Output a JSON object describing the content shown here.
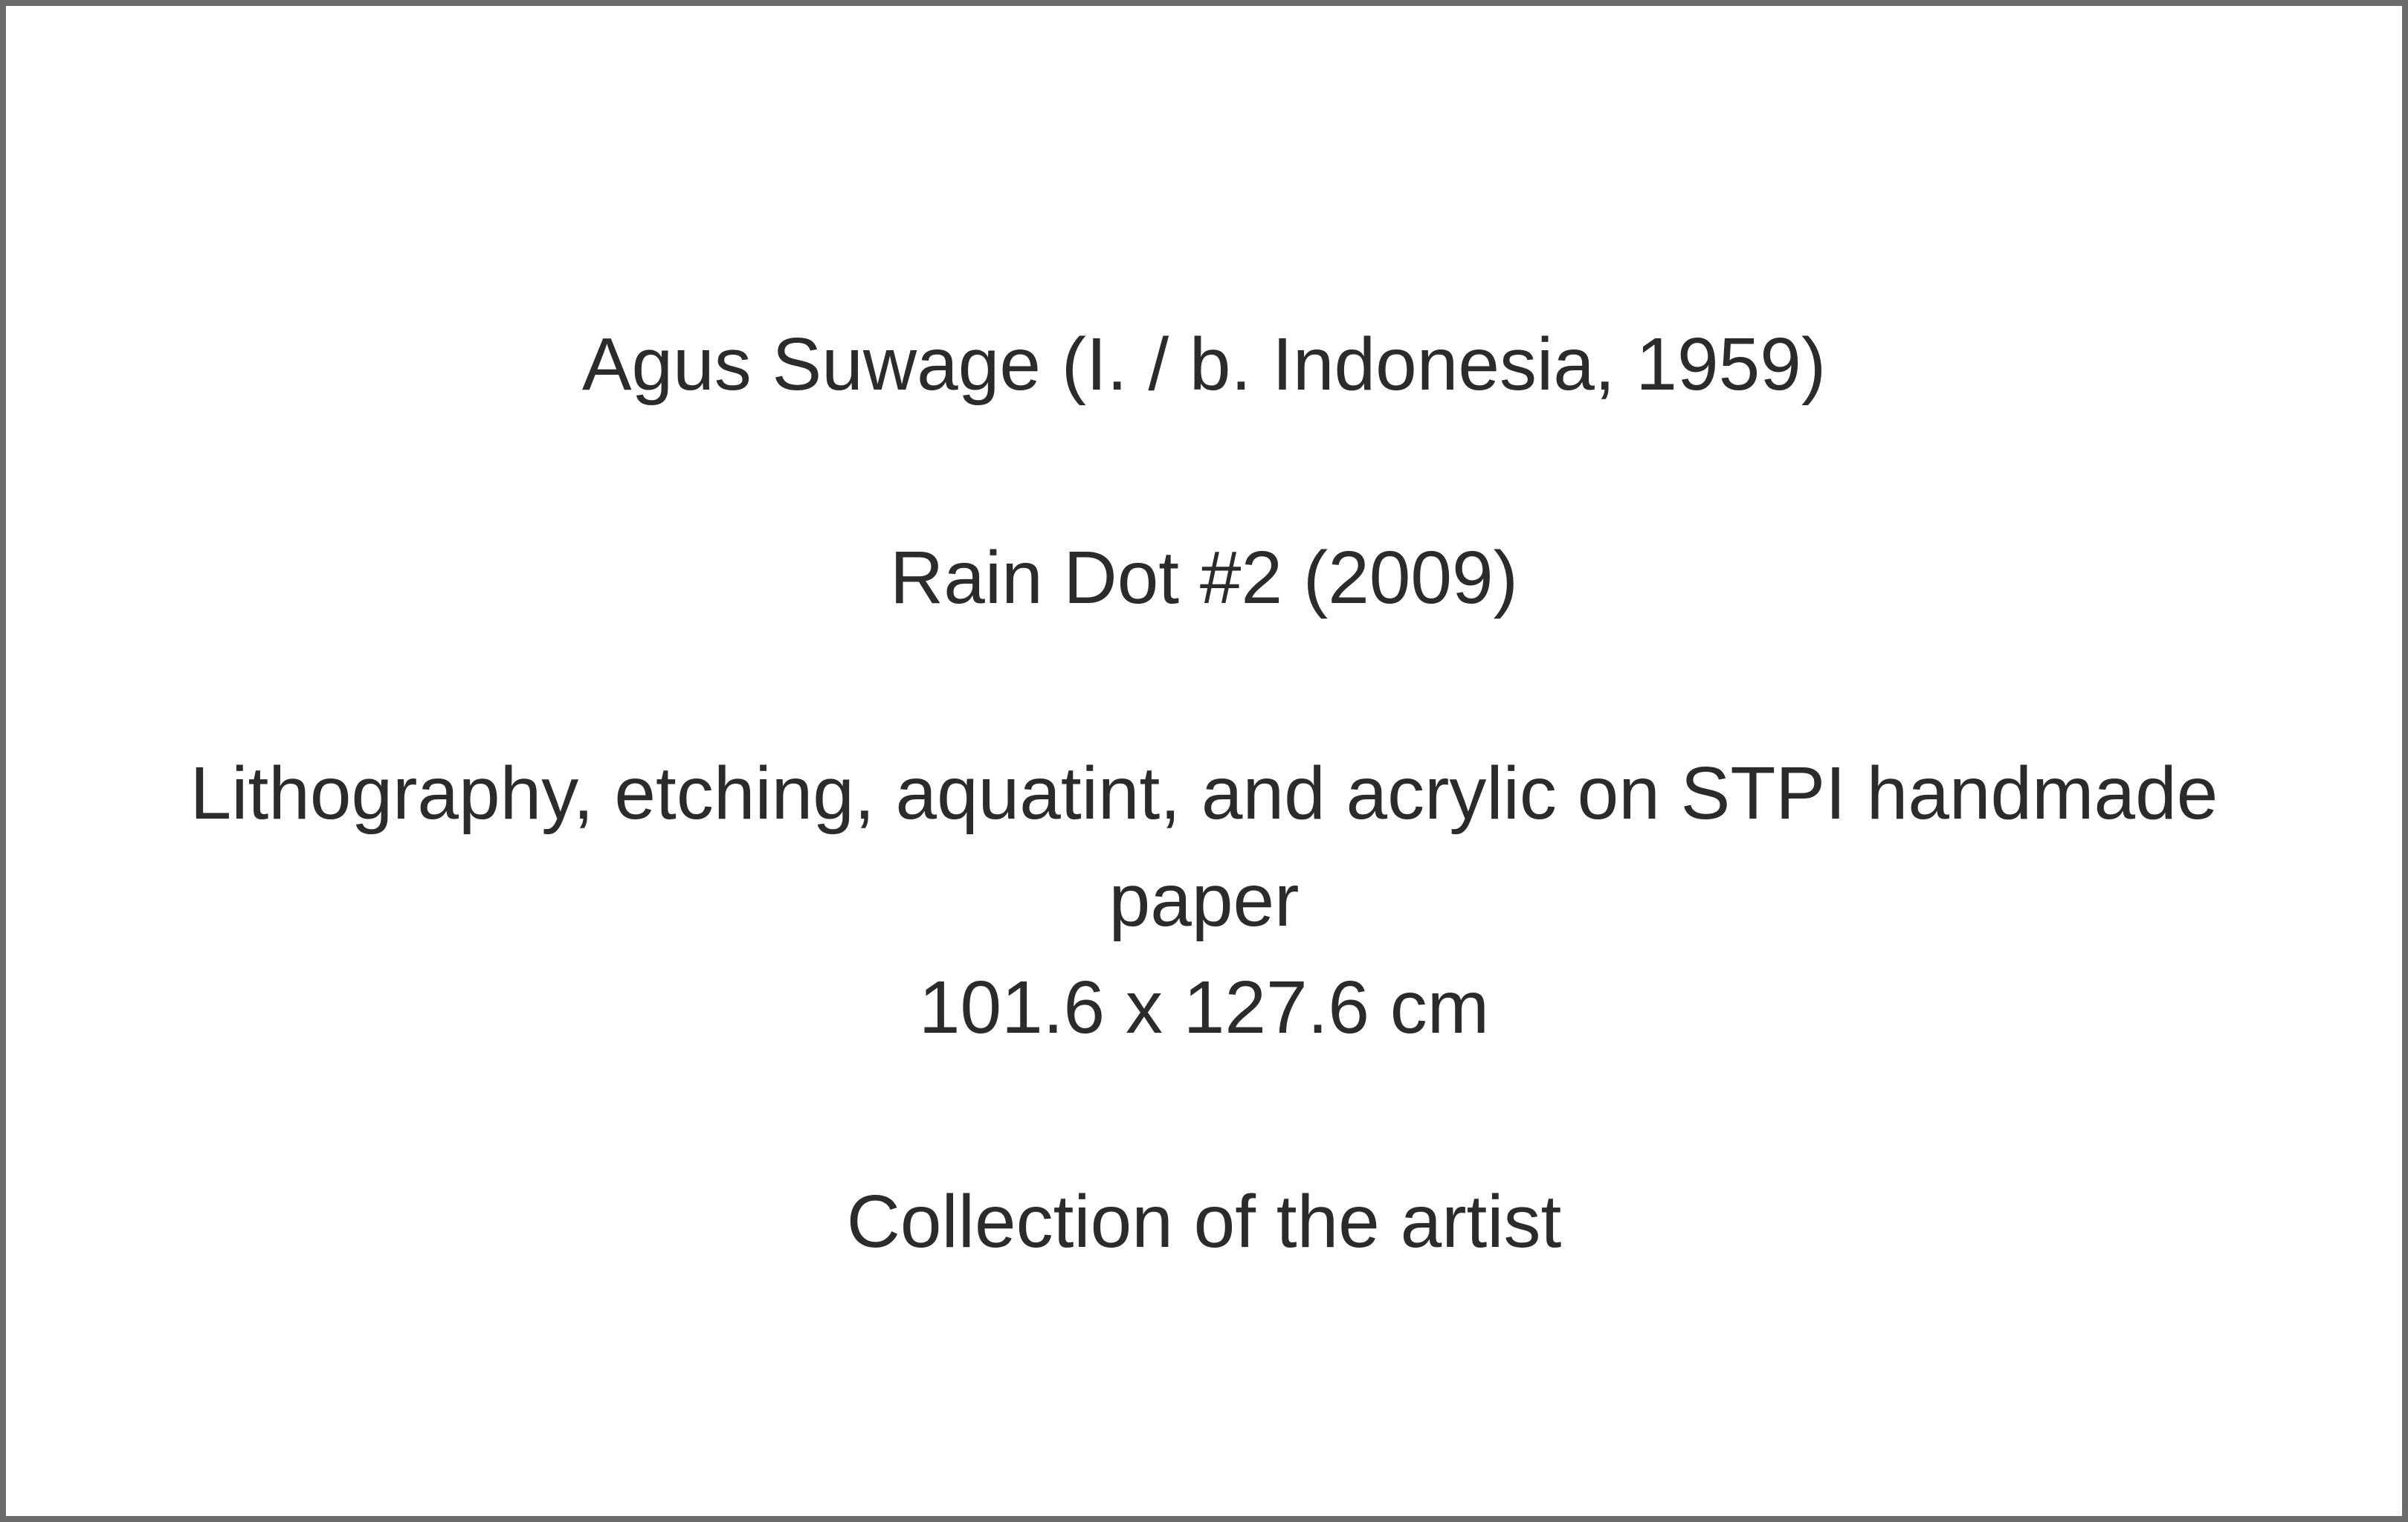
{
  "caption": {
    "artist_line": "Agus Suwage (I. / b. Indonesia, 1959)",
    "title_line": "Rain Dot #2 (2009)",
    "medium_line_1": "Lithography, etching, aquatint, and acrylic on STPI handmade",
    "medium_line_2": "paper",
    "dimensions_line": "101.6 x 127.6 cm",
    "collection_line": "Collection of the artist"
  },
  "colors": {
    "border": "#6b6b6b",
    "text": "#2b2b2b",
    "background": "#ffffff"
  }
}
